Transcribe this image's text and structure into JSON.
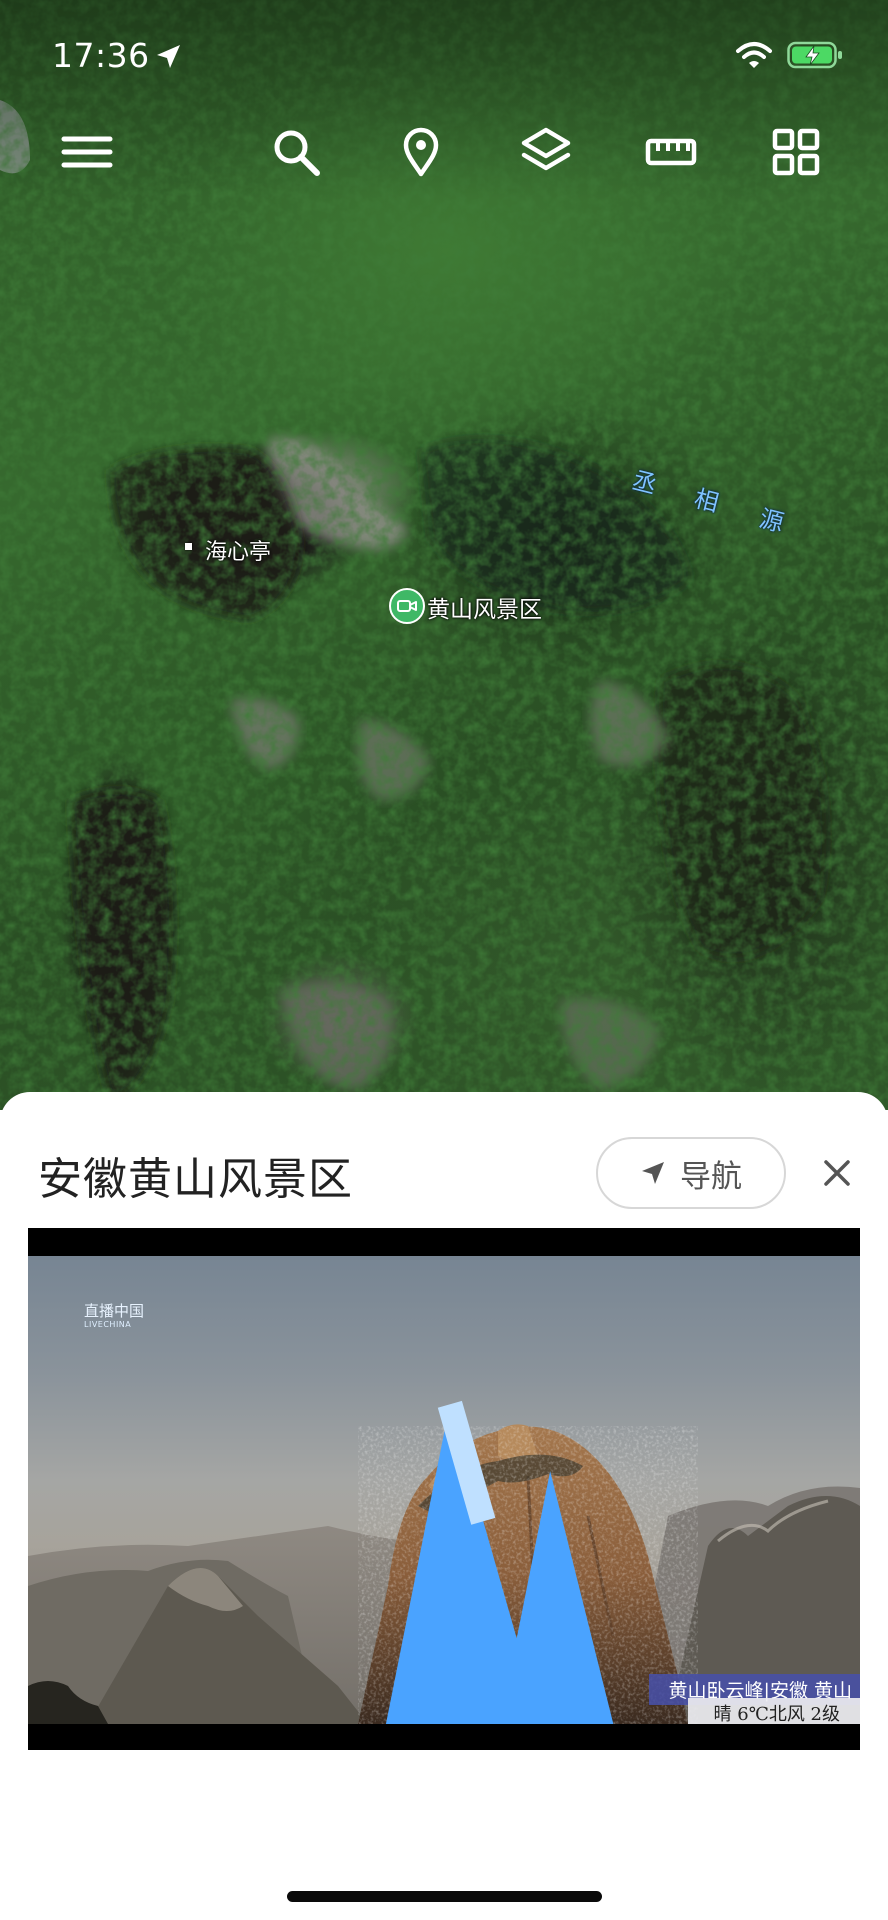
{
  "status_bar": {
    "time": "17:36",
    "icons": [
      "location-arrow-icon",
      "wifi-icon",
      "battery-charging-icon"
    ]
  },
  "toolbar": {
    "icons": [
      "menu-icon",
      "search-icon",
      "pin-icon",
      "layers-icon",
      "ruler-icon",
      "grid-icon"
    ]
  },
  "map": {
    "labels": {
      "pavilion": "海心亭",
      "scenic_area": "黄山风景区",
      "river": [
        "丞",
        "相",
        "源"
      ]
    },
    "colors": {
      "river_label": "#7fc3ff",
      "video_marker": "#3fb866"
    }
  },
  "sheet": {
    "title": "安徽黄山风景区",
    "nav_label": "导航",
    "video": {
      "logo_cn": "直播中国",
      "logo_en": "LIVECHINA",
      "caption": "黄山卧云峰|安徽 黄山",
      "weather": "晴 6℃北风 2级"
    }
  }
}
